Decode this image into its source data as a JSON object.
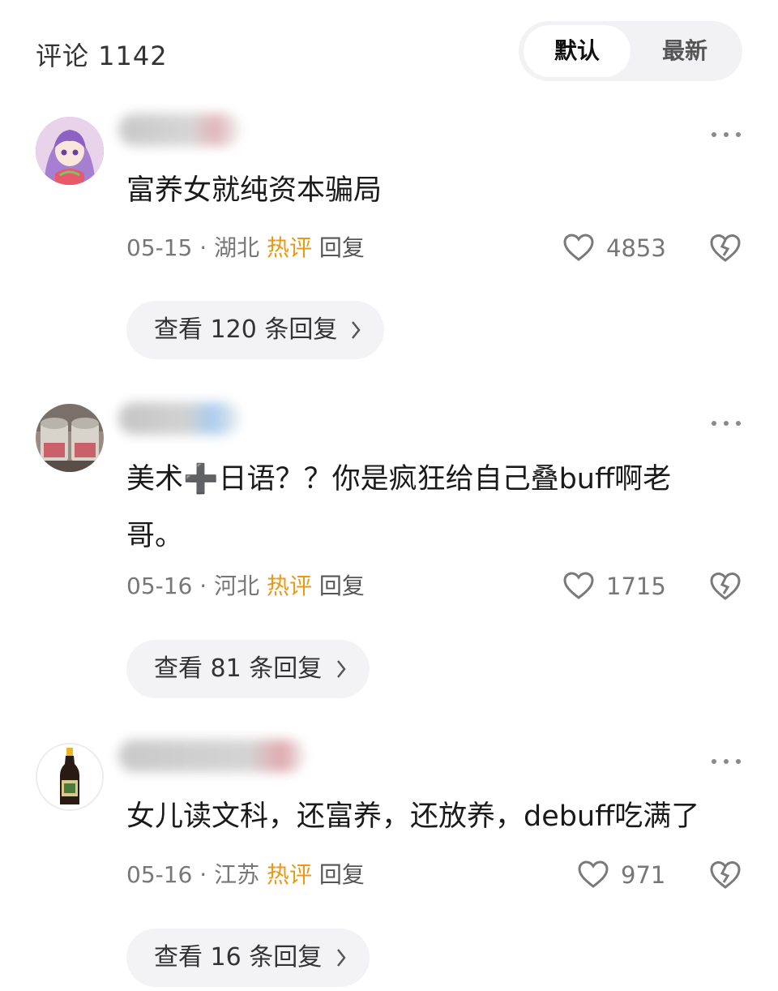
{
  "header": {
    "title": "评论 1142",
    "sort_default": "默认",
    "sort_latest": "最新"
  },
  "comments": [
    {
      "text": "富养女就纯资本骗局",
      "date": "05-15",
      "separator": " · ",
      "location": "湖北",
      "hot_label": "热评",
      "reply_label": "回复",
      "likes": "4853",
      "view_replies": "查看 120 条回复",
      "avatar_icon": "anime-girl-avatar"
    },
    {
      "text": "美术➕日语？？你是疯狂给自己叠buff啊老哥。",
      "date": "05-16",
      "separator": " · ",
      "location": "河北",
      "hot_label": "热评",
      "reply_label": "回复",
      "likes": "1715",
      "view_replies": "查看 81 条回复",
      "avatar_icon": "jars-photo-avatar"
    },
    {
      "text": "女儿读文科，还富养，还放养，debuff吃满了",
      "date": "05-16",
      "separator": " · ",
      "location": "江苏",
      "hot_label": "热评",
      "reply_label": "回复",
      "likes": "971",
      "view_replies": "查看 16 条回复",
      "avatar_icon": "sauce-bottle-avatar"
    }
  ],
  "icons": {
    "like": "heart-outline-icon",
    "dislike": "broken-heart-icon",
    "more": "more-dots-icon",
    "chevron": "chevron-right-icon"
  },
  "colors": {
    "hot_label": "#e69a16",
    "pill_background": "#f3f3f5",
    "meta_text": "#777777"
  }
}
